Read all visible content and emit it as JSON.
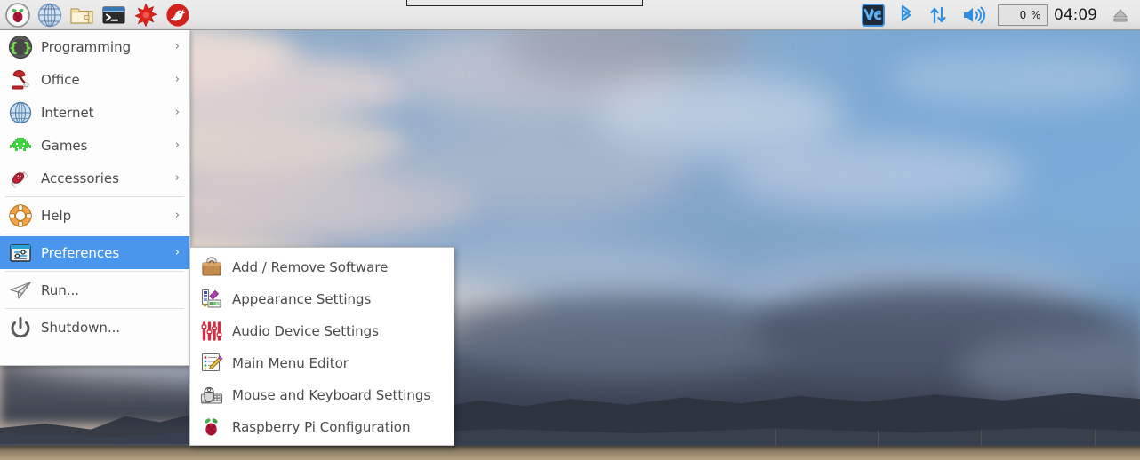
{
  "panel": {
    "launchers": [
      {
        "name": "raspberry-menu-icon",
        "label": "Menu"
      },
      {
        "name": "web-browser-icon",
        "label": "Web Browser"
      },
      {
        "name": "file-manager-icon",
        "label": "File Manager"
      },
      {
        "name": "terminal-icon",
        "label": "Terminal"
      },
      {
        "name": "mathematica-icon",
        "label": "Mathematica"
      },
      {
        "name": "wolfram-icon",
        "label": "Wolfram"
      }
    ],
    "task_button": {
      "title": ""
    },
    "tray": {
      "vnc_label": "VNC",
      "bluetooth_label": "Bluetooth",
      "network_label": "Network",
      "volume_label": "Volume",
      "cpu_value": "0 %",
      "clock": "04:09",
      "eject_label": "Eject"
    }
  },
  "main_menu": {
    "items": [
      {
        "label": "Programming",
        "icon": "programming-icon",
        "arrow": "›",
        "selected": false
      },
      {
        "label": "Office",
        "icon": "office-icon",
        "arrow": "›",
        "selected": false
      },
      {
        "label": "Internet",
        "icon": "internet-icon",
        "arrow": "›",
        "selected": false
      },
      {
        "label": "Games",
        "icon": "games-icon",
        "arrow": "›",
        "selected": false
      },
      {
        "label": "Accessories",
        "icon": "accessories-icon",
        "arrow": "›",
        "selected": false
      },
      {
        "label": "Help",
        "icon": "help-icon",
        "arrow": "›",
        "selected": false
      },
      {
        "label": "Preferences",
        "icon": "preferences-icon",
        "arrow": "›",
        "selected": true
      },
      {
        "label": "Run...",
        "icon": "run-icon",
        "arrow": "",
        "selected": false
      },
      {
        "label": "Shutdown...",
        "icon": "shutdown-icon",
        "arrow": "",
        "selected": false
      }
    ]
  },
  "submenu": {
    "parent": "Preferences",
    "items": [
      {
        "label": "Add / Remove Software",
        "icon": "package-icon"
      },
      {
        "label": "Appearance Settings",
        "icon": "palette-icon"
      },
      {
        "label": "Audio Device Settings",
        "icon": "sliders-icon"
      },
      {
        "label": "Main Menu Editor",
        "icon": "menu-editor-icon"
      },
      {
        "label": "Mouse and Keyboard Settings",
        "icon": "mouse-keyboard-icon"
      },
      {
        "label": "Raspberry Pi Configuration",
        "icon": "raspberry-icon"
      }
    ]
  },
  "colors": {
    "panel_bg": "#e8e8e8",
    "menu_bg": "#fdfdfd",
    "highlight": "#4a96ec",
    "text": "#4b4b4b",
    "highlight_text": "#ffffff"
  }
}
